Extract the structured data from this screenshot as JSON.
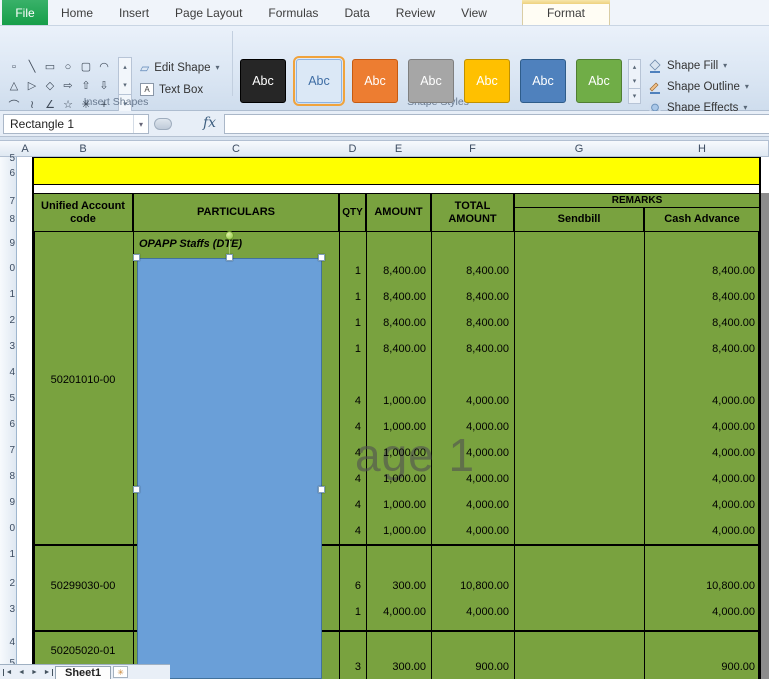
{
  "tabs": {
    "file": "File",
    "items": [
      "Home",
      "Insert",
      "Page Layout",
      "Formulas",
      "Data",
      "Review",
      "View"
    ],
    "contextual": "Format"
  },
  "ribbon": {
    "insert_shapes": {
      "label": "Insert Shapes",
      "edit_shape": "Edit Shape",
      "text_box": "Text Box",
      "gallery": [
        {
          "name": "select-shape",
          "glyph": "▫"
        },
        {
          "name": "line",
          "glyph": "╲"
        },
        {
          "name": "rectangle",
          "glyph": "▭"
        },
        {
          "name": "ellipse",
          "glyph": "○"
        },
        {
          "name": "rounded-rectangle",
          "glyph": "▢"
        },
        {
          "name": "arc",
          "glyph": "◠"
        },
        {
          "name": "triangle",
          "glyph": "△"
        },
        {
          "name": "right-triangle",
          "glyph": "▷"
        },
        {
          "name": "diamond",
          "glyph": "◇"
        },
        {
          "name": "arrow-right",
          "glyph": "⇨"
        },
        {
          "name": "arrow-up",
          "glyph": "⇧"
        },
        {
          "name": "arrow-down",
          "glyph": "⇩"
        },
        {
          "name": "curve",
          "glyph": "⌒"
        },
        {
          "name": "scribble",
          "glyph": "≀"
        },
        {
          "name": "angle",
          "glyph": "∠"
        },
        {
          "name": "star",
          "glyph": "☆"
        },
        {
          "name": "burst",
          "glyph": "✳"
        },
        {
          "name": "plus",
          "glyph": "+"
        }
      ]
    },
    "shape_styles": {
      "label": "Shape Styles",
      "swatch_label": "Abc",
      "swatches": [
        {
          "name": "style-dark",
          "bg": "#262626",
          "fg": "#ffffff",
          "border": "#000000",
          "selected": false
        },
        {
          "name": "style-light-blue",
          "bg": "#dbe8f6",
          "fg": "#3f6ea5",
          "border": "#8db3e2",
          "selected": true
        },
        {
          "name": "style-orange",
          "bg": "#ed7d31",
          "fg": "#ffffff",
          "border": "#c55a11",
          "selected": false
        },
        {
          "name": "style-gray",
          "bg": "#a6a6a6",
          "fg": "#ffffff",
          "border": "#7f7f7f",
          "selected": false
        },
        {
          "name": "style-gold",
          "bg": "#ffc000",
          "fg": "#ffffff",
          "border": "#bf9000",
          "selected": false
        },
        {
          "name": "style-blue",
          "bg": "#4f81bd",
          "fg": "#ffffff",
          "border": "#2e5c8a",
          "selected": false
        },
        {
          "name": "style-green",
          "bg": "#70ad47",
          "fg": "#ffffff",
          "border": "#507e32",
          "selected": false
        }
      ],
      "buttons": [
        {
          "label": "Shape Fill"
        },
        {
          "label": "Shape Outline"
        },
        {
          "label": "Shape Effects"
        }
      ]
    }
  },
  "formula_bar": {
    "name_box": "Rectangle 1",
    "fx": "fx",
    "value": ""
  },
  "sheet": {
    "columns": [
      "A",
      "B",
      "C",
      "D",
      "E",
      "F",
      "G",
      "H"
    ],
    "row_numbers": [
      "5",
      "6",
      "7",
      "8",
      "9",
      "0",
      "1",
      "2",
      "3",
      "4",
      "5",
      "6",
      "7",
      "8",
      "9",
      "0",
      "1",
      "2",
      "3",
      "4",
      "5"
    ],
    "headers": {
      "account": "Unified Account code",
      "particulars": "PARTICULARS",
      "qty": "QTY",
      "amount": "AMOUNT",
      "total": "TOTAL AMOUNT",
      "remarks": "REMARKS",
      "sendbill": "Sendbill",
      "cash_advance": "Cash Advance"
    },
    "blocks": [
      {
        "code": "50201010-00"
      },
      {
        "code": "50299030-00"
      },
      {
        "code": "50205020-01"
      }
    ],
    "shape_label": "OPAPP Staffs (DTE)",
    "watermark": "age 1",
    "rows": [
      {
        "qty": "",
        "amount": "",
        "total": "",
        "sendbill": "",
        "cash": ""
      },
      {
        "qty": "1",
        "amount": "8,400.00",
        "total": "8,400.00",
        "sendbill": "",
        "cash": "8,400.00"
      },
      {
        "qty": "1",
        "amount": "8,400.00",
        "total": "8,400.00",
        "sendbill": "",
        "cash": "8,400.00"
      },
      {
        "qty": "1",
        "amount": "8,400.00",
        "total": "8,400.00",
        "sendbill": "",
        "cash": "8,400.00"
      },
      {
        "qty": "1",
        "amount": "8,400.00",
        "total": "8,400.00",
        "sendbill": "",
        "cash": "8,400.00"
      },
      {
        "qty": "",
        "amount": "",
        "total": "",
        "sendbill": "",
        "cash": ""
      },
      {
        "qty": "4",
        "amount": "1,000.00",
        "total": "4,000.00",
        "sendbill": "",
        "cash": "4,000.00"
      },
      {
        "qty": "4",
        "amount": "1,000.00",
        "total": "4,000.00",
        "sendbill": "",
        "cash": "4,000.00"
      },
      {
        "qty": "4",
        "amount": "1,000.00",
        "total": "4,000.00",
        "sendbill": "",
        "cash": "4,000.00"
      },
      {
        "qty": "4",
        "amount": "1,000.00",
        "total": "4,000.00",
        "sendbill": "",
        "cash": "4,000.00"
      },
      {
        "qty": "4",
        "amount": "1,000.00",
        "total": "4,000.00",
        "sendbill": "",
        "cash": "4,000.00"
      },
      {
        "qty": "4",
        "amount": "1,000.00",
        "total": "4,000.00",
        "sendbill": "",
        "cash": "4,000.00"
      },
      {
        "qty": "",
        "amount": "",
        "total": "",
        "sendbill": "",
        "cash": ""
      },
      {
        "qty": "6",
        "amount": "300.00",
        "total": "10,800.00",
        "sendbill": "",
        "cash": "10,800.00"
      },
      {
        "qty": "1",
        "amount": "4,000.00",
        "total": "4,000.00",
        "sendbill": "",
        "cash": "4,000.00"
      },
      {
        "qty": "",
        "amount": "",
        "total": "",
        "sendbill": "",
        "cash": ""
      },
      {
        "qty": "3",
        "amount": "300.00",
        "total": "900.00",
        "sendbill": "",
        "cash": "900.00"
      }
    ],
    "tab_bar": {
      "nav": [
        "◄",
        "◄",
        "►",
        "►"
      ],
      "sheet": "Sheet1"
    }
  },
  "icons": {
    "dropdown": "▾",
    "up": "▴",
    "down": "▾",
    "edit_shape": "▱",
    "text_box": "A",
    "insert_sheet": "✳"
  }
}
